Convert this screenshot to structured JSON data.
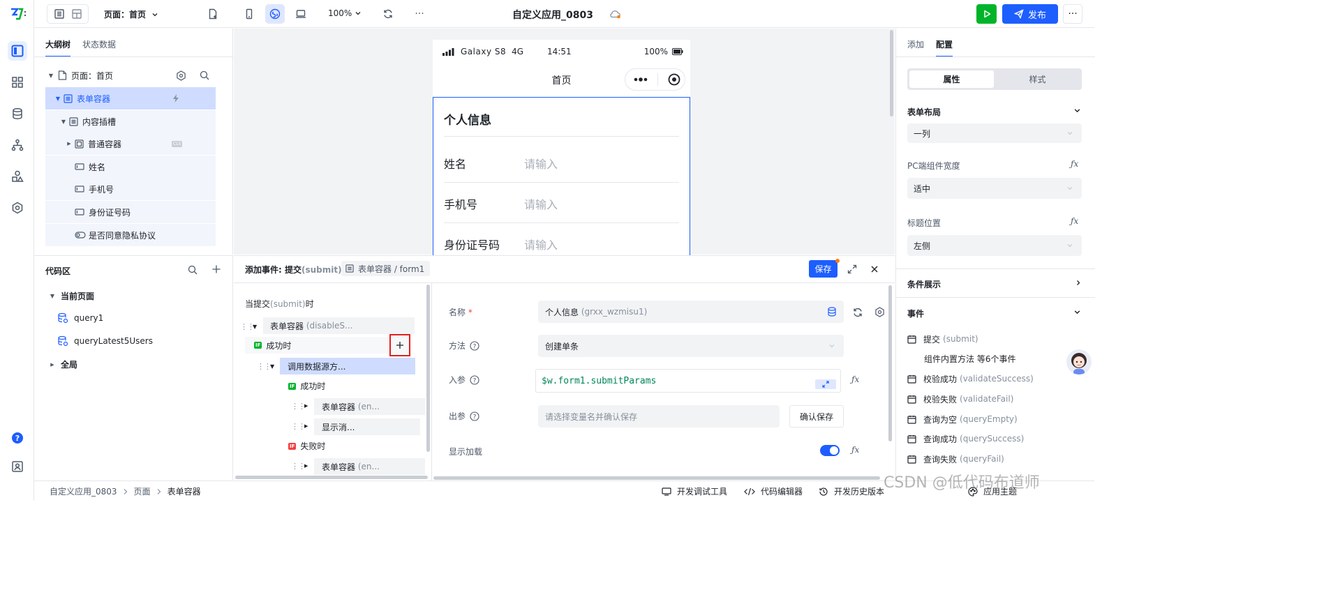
{
  "toolbar": {
    "page_label": "页面：首页",
    "zoom": "100%",
    "app_title": "自定义应用_0803",
    "publish": "发布",
    "more": "···"
  },
  "left_panel": {
    "tabs": [
      "大纲树",
      "状态数据"
    ],
    "tree": [
      {
        "label": "页面：首页"
      },
      {
        "label": "表单容器"
      },
      {
        "label": "内容插槽"
      },
      {
        "label": "普通容器",
        "badge": "CLS"
      },
      {
        "label": "姓名"
      },
      {
        "label": "手机号"
      },
      {
        "label": "身份证号码"
      },
      {
        "label": "是否同意隐私协议"
      }
    ]
  },
  "code_panel": {
    "title": "代码区",
    "current_page": "当前页面",
    "queries": [
      "query1",
      "queryLatest5Users"
    ],
    "global": "全局"
  },
  "phone": {
    "status": {
      "device": "Galaxy S8",
      "network": "4G",
      "time": "14:51",
      "battery": "100%"
    },
    "nav_title": "首页",
    "form_title": "个人信息",
    "fields": [
      {
        "label": "姓名",
        "placeholder": "请输入"
      },
      {
        "label": "手机号",
        "placeholder": "请输入"
      },
      {
        "label": "身份证号码",
        "placeholder": "请输入"
      }
    ]
  },
  "event_editor": {
    "title": "添加事件: 提交",
    "title_code": "(submit)",
    "breadcrumb": "表单容器 / form1",
    "save": "保存",
    "flow": {
      "trigger": "当提交",
      "trigger_code": "(submit)",
      "trigger_suffix": "时",
      "n1": "表单容器",
      "n1_code": "(disableS...",
      "success": "成功时",
      "call": "调用数据源方...",
      "success2": "成功时",
      "n2": "表单容器",
      "n2_code": "(en...",
      "n3": "显示消...",
      "fail": "失败时",
      "n4": "表单容器",
      "n4_code": "(en...",
      "if_badge": "IF"
    },
    "form": {
      "name_label": "名称",
      "name_value": "个人信息",
      "name_code": "(grxx_wzmisu1)",
      "method_label": "方法",
      "method_value": "创建单条",
      "input_label": "入参",
      "input_value": "$w.form1.submitParams",
      "output_label": "出参",
      "output_placeholder": "请选择变量名并确认保存",
      "confirm_save": "确认保存",
      "loading_label": "显示加载"
    }
  },
  "right_panel": {
    "tabs": [
      "添加",
      "配置"
    ],
    "seg": [
      "属性",
      "样式"
    ],
    "form_layout": "表单布局",
    "layout_value": "一列",
    "pc_width_label": "PC端组件宽度",
    "pc_width_value": "适中",
    "title_pos_label": "标题位置",
    "title_pos_value": "左侧",
    "condition": "条件展示",
    "events_title": "事件",
    "events": [
      {
        "label": "提交",
        "code": "(submit)"
      },
      {
        "label": "组件内置方法 等6个事件",
        "code": ""
      },
      {
        "label": "校验成功",
        "code": "(validateSuccess)"
      },
      {
        "label": "校验失败",
        "code": "(validateFail)"
      },
      {
        "label": "查询为空",
        "code": "(queryEmpty)"
      },
      {
        "label": "查询成功",
        "code": "(querySuccess)"
      },
      {
        "label": "查询失败",
        "code": "(queryFail)"
      }
    ]
  },
  "statusbar": {
    "crumbs": [
      "自定义应用_0803",
      "页面",
      "表单容器"
    ],
    "dev_tools": "开发调试工具",
    "code_editor": "代码编辑器",
    "history": "开发历史版本",
    "theme": "应用主题",
    "watermark": "CSDN @低代码布道师"
  },
  "colors": {
    "accent": "#1d5eff",
    "run": "#00b42a",
    "selected_bg": "#cfdcff",
    "highlight": "#e02020"
  }
}
